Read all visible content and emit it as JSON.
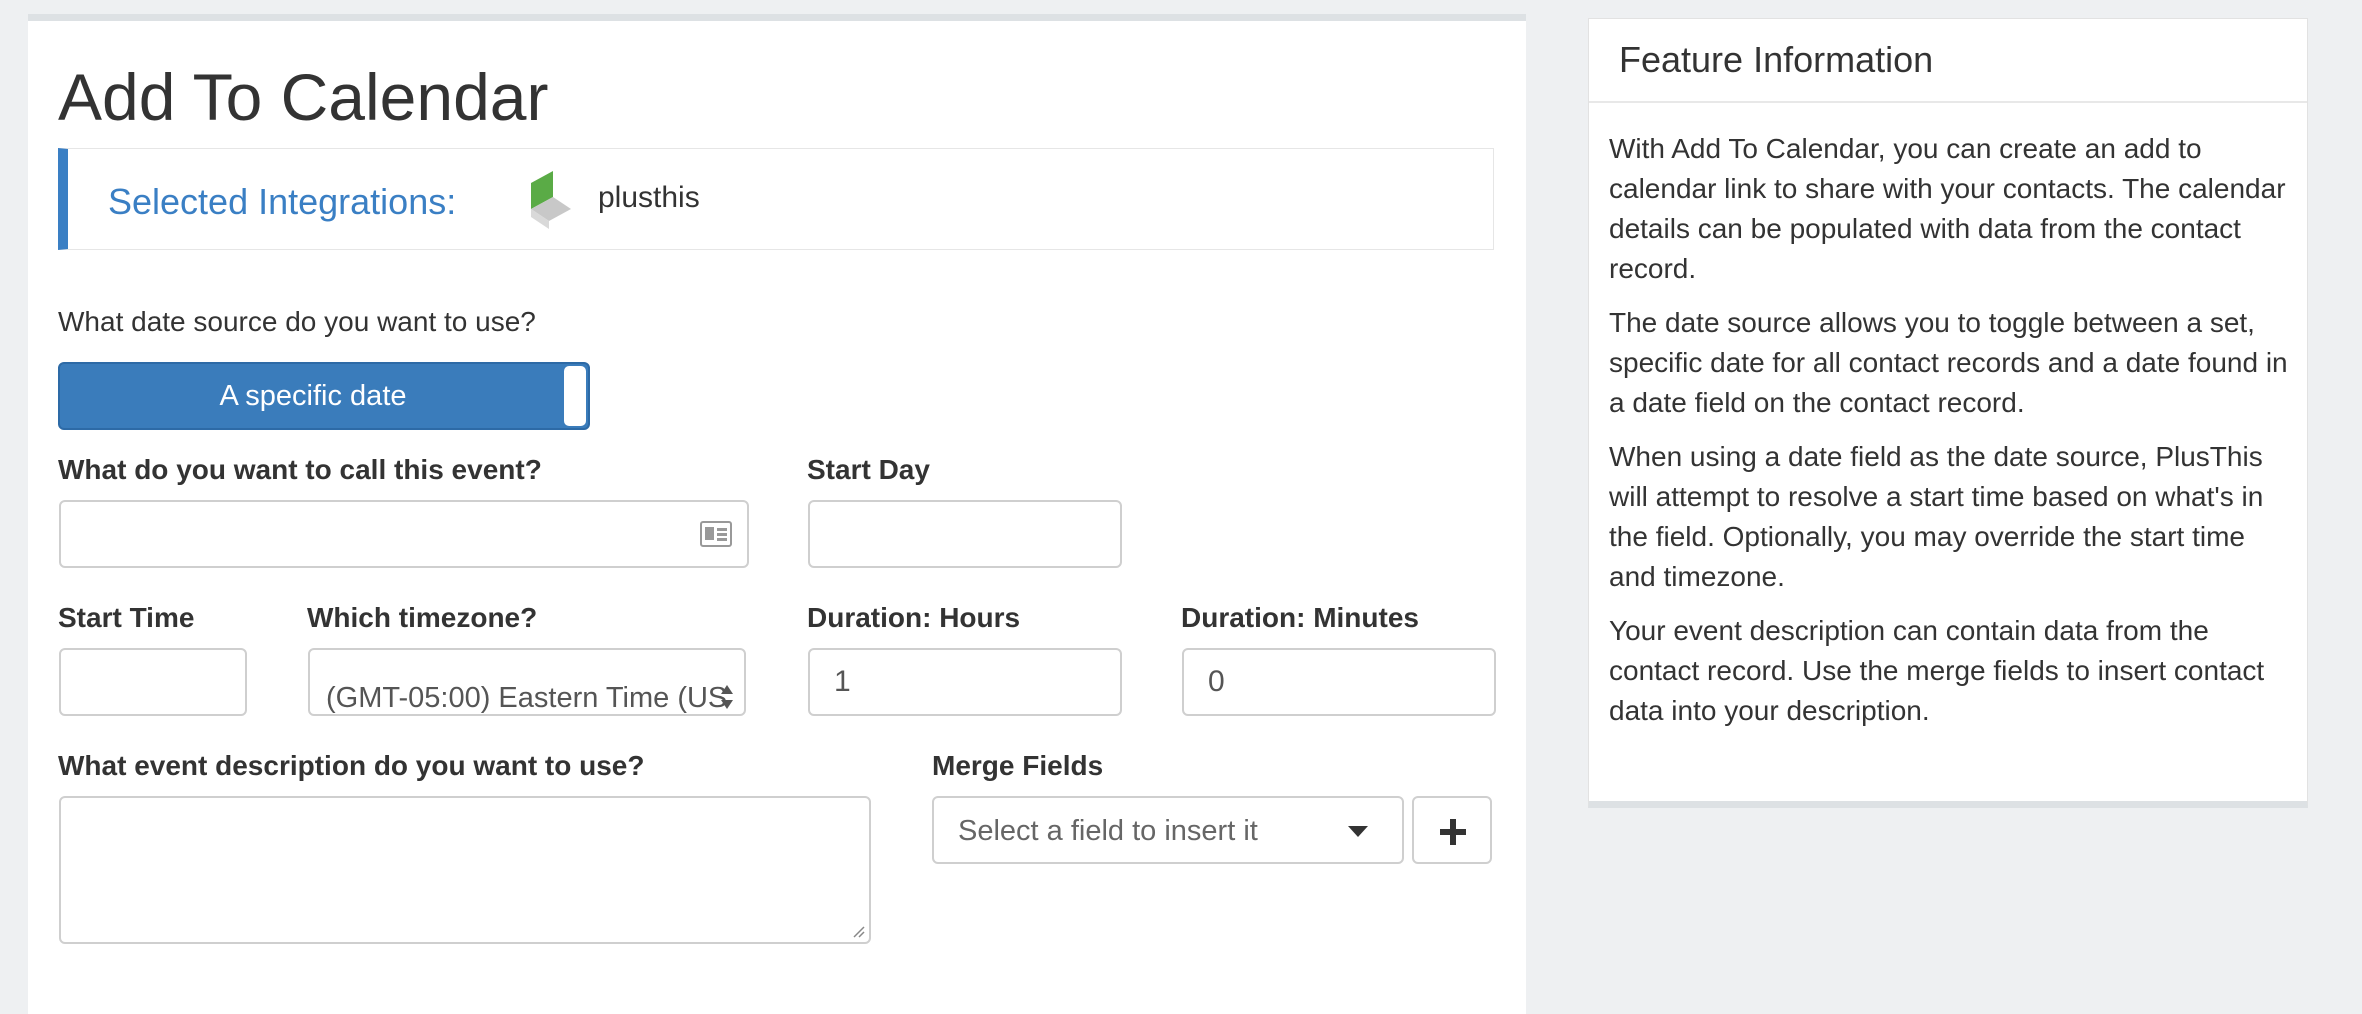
{
  "page_title": "Add To Calendar",
  "integrations": {
    "label": "Selected Integrations:",
    "items": [
      {
        "name": "plusthis",
        "icon": "plusthis-logo-icon"
      }
    ]
  },
  "date_source": {
    "question": "What date source do you want to use?",
    "toggle_label": "A specific date"
  },
  "event_name": {
    "label": "What do you want to call this event?",
    "value": "",
    "icon": "contact-card-icon"
  },
  "start_day": {
    "label": "Start Day",
    "value": ""
  },
  "start_time": {
    "label": "Start Time",
    "value": ""
  },
  "timezone": {
    "label": "Which timezone?",
    "selected": "(GMT-05:00) Eastern Time (US"
  },
  "duration_hours": {
    "label": "Duration: Hours",
    "value": "1"
  },
  "duration_minutes": {
    "label": "Duration: Minutes",
    "value": "0"
  },
  "description": {
    "label": "What event description do you want to use?",
    "value": ""
  },
  "merge_fields": {
    "label": "Merge Fields",
    "placeholder": "Select a field to insert it",
    "add_icon": "plus-icon"
  },
  "feature_info": {
    "title": "Feature Information",
    "paragraphs": [
      "With Add To Calendar, you can create an add to calendar link to share with your contacts. The calendar details can be populated with data from the contact record.",
      "The date source allows you to toggle between a set, specific date for all contact records and a date found in a date field on the contact record.",
      "When using a date field as the date source, PlusThis will attempt to resolve a start time based on what's in the field. Optionally, you may override the start time and timezone.",
      "Your event description can contain data from the contact record. Use the merge fields to insert contact data into your description."
    ]
  },
  "colors": {
    "accent": "#3a7fc4",
    "toggle": "#3a7cbb",
    "logo_green": "#5aab46",
    "logo_gray": "#c8c8c8"
  }
}
